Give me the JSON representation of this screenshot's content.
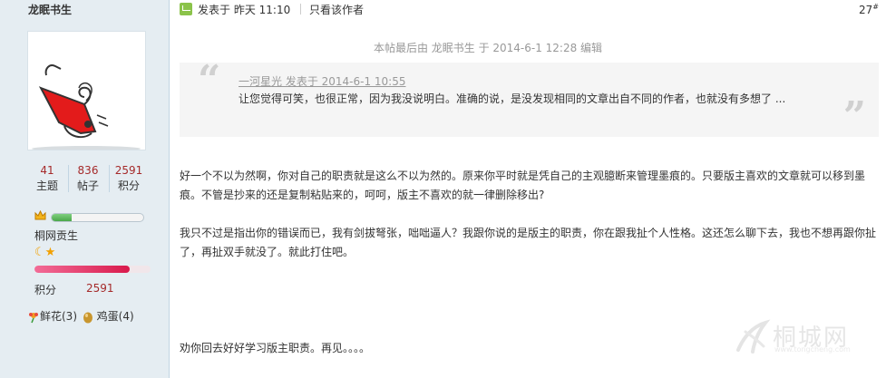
{
  "author": {
    "name": "龙眠书生",
    "stats": [
      {
        "value": "41",
        "label": "主题"
      },
      {
        "value": "836",
        "label": "帖子"
      },
      {
        "value": "2591",
        "label": "积分"
      }
    ],
    "group": "桐网贡生",
    "level_progress": 0.22,
    "credit_progress": 0.82,
    "credit_label": "积分",
    "credit_value": "2591",
    "gifts": [
      {
        "icon": "flower-icon",
        "text": "鲜花(3)"
      },
      {
        "icon": "egg-icon",
        "text": "鸡蛋(4)"
      }
    ]
  },
  "post": {
    "posted_label": "发表于",
    "posted_time": "昨天 11:10",
    "only_author": "只看该作者",
    "floor": "27",
    "floor_mark": "#",
    "edited_note": "本帖最后由 龙眠书生 于 2014-6-1 12:28 编辑",
    "quote_author": "一河星光 发表于 2014-6-1 10:55",
    "quote_text": "让您觉得可笑，也很正常，因为我没说明白。准确的说，是没发现相同的文章出自不同的作者，也就没有多想了 ...",
    "paragraphs": [
      "好一个不以为然啊，你对自己的职责就是这么不以为然的。原来你平时就是凭自己的主观臆断来管理墨痕的。只要版主喜欢的文章就可以移到墨痕。不管是抄来的还是复制粘贴来的，呵呵，版主不喜欢的就一律删除移出?",
      "我只不过是指出你的错误而已，我有剑拔弩张，咄咄逼人？我跟你说的是版主的职责，你在跟我扯个人性格。这还怎么聊下去，我也不想再跟你扯了，再扯双手就没了。就此打住吧。",
      "劝你回去好好学习版主职责。再见。。。。"
    ]
  },
  "watermark": {
    "text": "桐城网",
    "url": "www.tongcheng.com"
  }
}
